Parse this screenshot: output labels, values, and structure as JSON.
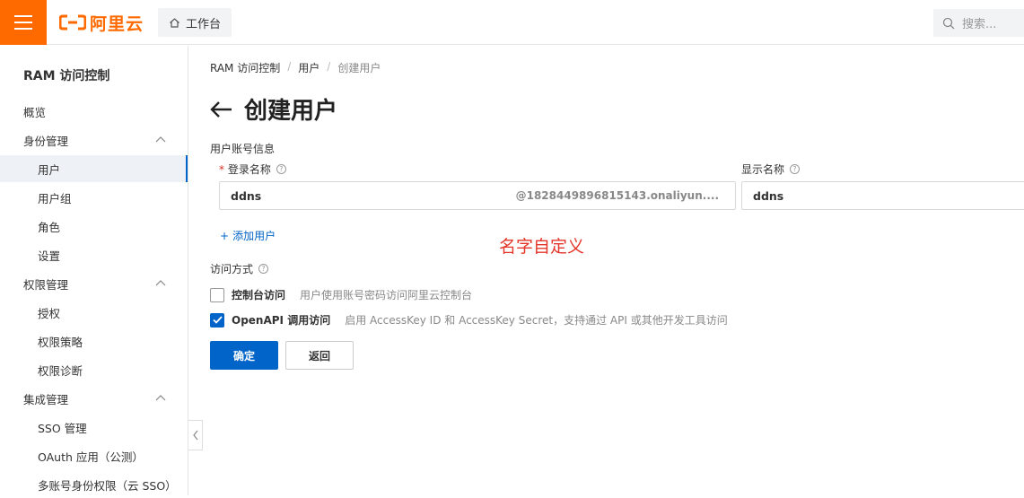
{
  "topbar": {
    "logo_text": "阿里云",
    "workbench_label": "工作台",
    "search_placeholder": "搜索..."
  },
  "sidebar": {
    "title": "RAM 访问控制",
    "items": [
      {
        "label": "概览"
      },
      {
        "label": "身份管理"
      },
      {
        "label": "用户"
      },
      {
        "label": "用户组"
      },
      {
        "label": "角色"
      },
      {
        "label": "设置"
      },
      {
        "label": "权限管理"
      },
      {
        "label": "授权"
      },
      {
        "label": "权限策略"
      },
      {
        "label": "权限诊断"
      },
      {
        "label": "集成管理"
      },
      {
        "label": "SSO 管理"
      },
      {
        "label": "OAuth 应用（公测）"
      },
      {
        "label": "多账号身份权限（云 SSO）"
      }
    ]
  },
  "breadcrumb": [
    "RAM 访问控制",
    "用户",
    "创建用户"
  ],
  "page_title": "创建用户",
  "form": {
    "section_account": "用户账号信息",
    "login_name_label": "登录名称",
    "login_name_value": "ddns",
    "login_name_suffix": "@1828449896815143.onaliyun....",
    "display_name_label": "显示名称",
    "display_name_value": "ddns",
    "add_user": "添加用户",
    "annotation": "名字自定义",
    "section_access": "访问方式",
    "console_label": "控制台访问",
    "console_desc": "用户使用账号密码访问阿里云控制台",
    "console_checked": false,
    "openapi_label": "OpenAPI 调用访问",
    "openapi_desc": "启用 AccessKey ID 和 AccessKey Secret，支持通过 API 或其他开发工具访问",
    "openapi_checked": true,
    "confirm_button": "确定",
    "back_button": "返回"
  },
  "colors": {
    "brand": "#ff6a00",
    "primary": "#0064c8",
    "annotation": "#e4362a"
  }
}
